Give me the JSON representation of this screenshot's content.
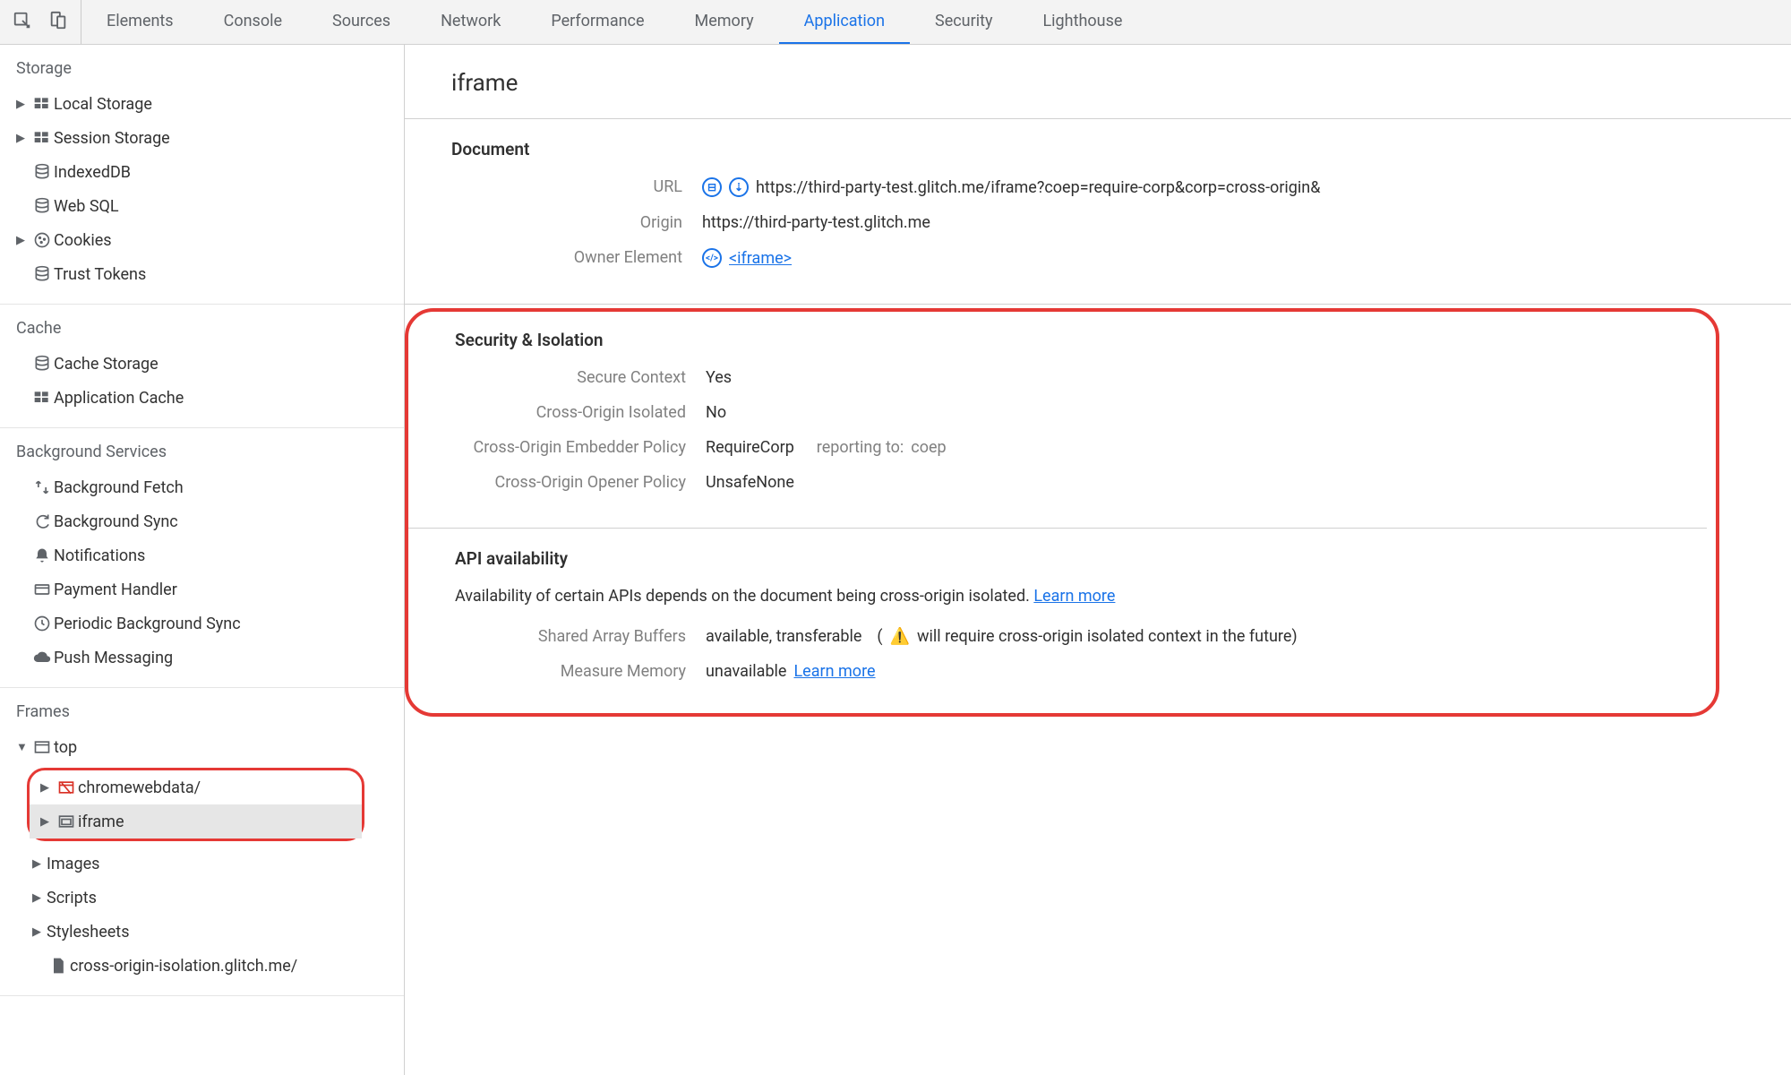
{
  "tabs": [
    "Elements",
    "Console",
    "Sources",
    "Network",
    "Performance",
    "Memory",
    "Application",
    "Security",
    "Lighthouse"
  ],
  "active_tab": "Application",
  "sidebar": {
    "storage": {
      "title": "Storage",
      "items": [
        "Local Storage",
        "Session Storage",
        "IndexedDB",
        "Web SQL",
        "Cookies",
        "Trust Tokens"
      ]
    },
    "cache": {
      "title": "Cache",
      "items": [
        "Cache Storage",
        "Application Cache"
      ]
    },
    "bg": {
      "title": "Background Services",
      "items": [
        "Background Fetch",
        "Background Sync",
        "Notifications",
        "Payment Handler",
        "Periodic Background Sync",
        "Push Messaging"
      ]
    },
    "frames": {
      "title": "Frames",
      "top": "top",
      "children": [
        "chromewebdata/",
        "iframe"
      ],
      "post": [
        "Images",
        "Scripts",
        "Stylesheets",
        "cross-origin-isolation.glitch.me/"
      ]
    }
  },
  "panel": {
    "title": "iframe",
    "document": {
      "heading": "Document",
      "url_label": "URL",
      "url_value": "https://third-party-test.glitch.me/iframe?coep=require-corp&corp=cross-origin&",
      "origin_label": "Origin",
      "origin_value": "https://third-party-test.glitch.me",
      "owner_label": "Owner Element",
      "owner_link": "<iframe>"
    },
    "security": {
      "heading": "Security & Isolation",
      "rows": [
        {
          "label": "Secure Context",
          "value": "Yes"
        },
        {
          "label": "Cross-Origin Isolated",
          "value": "No"
        },
        {
          "label": "Cross-Origin Embedder Policy",
          "value": "RequireCorp",
          "extra_label": "reporting to:",
          "extra_value": "coep"
        },
        {
          "label": "Cross-Origin Opener Policy",
          "value": "UnsafeNone"
        }
      ]
    },
    "api": {
      "heading": "API availability",
      "desc": "Availability of certain APIs depends on the document being cross-origin isolated.",
      "learn": "Learn more",
      "rows": [
        {
          "label": "Shared Array Buffers",
          "value": "available, transferable",
          "warn": "will require cross-origin isolated context in the future)"
        },
        {
          "label": "Measure Memory",
          "value": "unavailable",
          "link": "Learn more"
        }
      ]
    }
  }
}
